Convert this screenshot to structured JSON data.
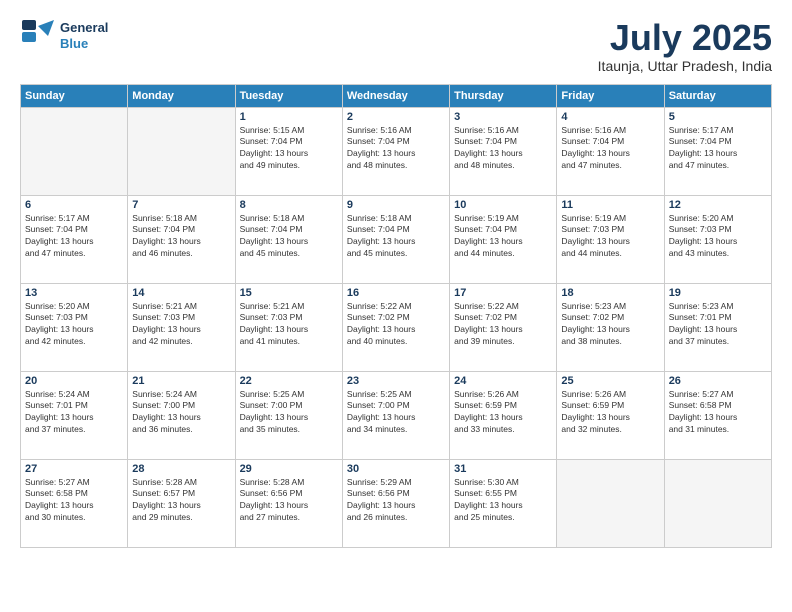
{
  "header": {
    "logo_line1": "General",
    "logo_line2": "Blue",
    "month": "July 2025",
    "location": "Itaunja, Uttar Pradesh, India"
  },
  "weekdays": [
    "Sunday",
    "Monday",
    "Tuesday",
    "Wednesday",
    "Thursday",
    "Friday",
    "Saturday"
  ],
  "weeks": [
    [
      {
        "day": "",
        "info": ""
      },
      {
        "day": "",
        "info": ""
      },
      {
        "day": "1",
        "info": "Sunrise: 5:15 AM\nSunset: 7:04 PM\nDaylight: 13 hours\nand 49 minutes."
      },
      {
        "day": "2",
        "info": "Sunrise: 5:16 AM\nSunset: 7:04 PM\nDaylight: 13 hours\nand 48 minutes."
      },
      {
        "day": "3",
        "info": "Sunrise: 5:16 AM\nSunset: 7:04 PM\nDaylight: 13 hours\nand 48 minutes."
      },
      {
        "day": "4",
        "info": "Sunrise: 5:16 AM\nSunset: 7:04 PM\nDaylight: 13 hours\nand 47 minutes."
      },
      {
        "day": "5",
        "info": "Sunrise: 5:17 AM\nSunset: 7:04 PM\nDaylight: 13 hours\nand 47 minutes."
      }
    ],
    [
      {
        "day": "6",
        "info": "Sunrise: 5:17 AM\nSunset: 7:04 PM\nDaylight: 13 hours\nand 47 minutes."
      },
      {
        "day": "7",
        "info": "Sunrise: 5:18 AM\nSunset: 7:04 PM\nDaylight: 13 hours\nand 46 minutes."
      },
      {
        "day": "8",
        "info": "Sunrise: 5:18 AM\nSunset: 7:04 PM\nDaylight: 13 hours\nand 45 minutes."
      },
      {
        "day": "9",
        "info": "Sunrise: 5:18 AM\nSunset: 7:04 PM\nDaylight: 13 hours\nand 45 minutes."
      },
      {
        "day": "10",
        "info": "Sunrise: 5:19 AM\nSunset: 7:04 PM\nDaylight: 13 hours\nand 44 minutes."
      },
      {
        "day": "11",
        "info": "Sunrise: 5:19 AM\nSunset: 7:03 PM\nDaylight: 13 hours\nand 44 minutes."
      },
      {
        "day": "12",
        "info": "Sunrise: 5:20 AM\nSunset: 7:03 PM\nDaylight: 13 hours\nand 43 minutes."
      }
    ],
    [
      {
        "day": "13",
        "info": "Sunrise: 5:20 AM\nSunset: 7:03 PM\nDaylight: 13 hours\nand 42 minutes."
      },
      {
        "day": "14",
        "info": "Sunrise: 5:21 AM\nSunset: 7:03 PM\nDaylight: 13 hours\nand 42 minutes."
      },
      {
        "day": "15",
        "info": "Sunrise: 5:21 AM\nSunset: 7:03 PM\nDaylight: 13 hours\nand 41 minutes."
      },
      {
        "day": "16",
        "info": "Sunrise: 5:22 AM\nSunset: 7:02 PM\nDaylight: 13 hours\nand 40 minutes."
      },
      {
        "day": "17",
        "info": "Sunrise: 5:22 AM\nSunset: 7:02 PM\nDaylight: 13 hours\nand 39 minutes."
      },
      {
        "day": "18",
        "info": "Sunrise: 5:23 AM\nSunset: 7:02 PM\nDaylight: 13 hours\nand 38 minutes."
      },
      {
        "day": "19",
        "info": "Sunrise: 5:23 AM\nSunset: 7:01 PM\nDaylight: 13 hours\nand 37 minutes."
      }
    ],
    [
      {
        "day": "20",
        "info": "Sunrise: 5:24 AM\nSunset: 7:01 PM\nDaylight: 13 hours\nand 37 minutes."
      },
      {
        "day": "21",
        "info": "Sunrise: 5:24 AM\nSunset: 7:00 PM\nDaylight: 13 hours\nand 36 minutes."
      },
      {
        "day": "22",
        "info": "Sunrise: 5:25 AM\nSunset: 7:00 PM\nDaylight: 13 hours\nand 35 minutes."
      },
      {
        "day": "23",
        "info": "Sunrise: 5:25 AM\nSunset: 7:00 PM\nDaylight: 13 hours\nand 34 minutes."
      },
      {
        "day": "24",
        "info": "Sunrise: 5:26 AM\nSunset: 6:59 PM\nDaylight: 13 hours\nand 33 minutes."
      },
      {
        "day": "25",
        "info": "Sunrise: 5:26 AM\nSunset: 6:59 PM\nDaylight: 13 hours\nand 32 minutes."
      },
      {
        "day": "26",
        "info": "Sunrise: 5:27 AM\nSunset: 6:58 PM\nDaylight: 13 hours\nand 31 minutes."
      }
    ],
    [
      {
        "day": "27",
        "info": "Sunrise: 5:27 AM\nSunset: 6:58 PM\nDaylight: 13 hours\nand 30 minutes."
      },
      {
        "day": "28",
        "info": "Sunrise: 5:28 AM\nSunset: 6:57 PM\nDaylight: 13 hours\nand 29 minutes."
      },
      {
        "day": "29",
        "info": "Sunrise: 5:28 AM\nSunset: 6:56 PM\nDaylight: 13 hours\nand 27 minutes."
      },
      {
        "day": "30",
        "info": "Sunrise: 5:29 AM\nSunset: 6:56 PM\nDaylight: 13 hours\nand 26 minutes."
      },
      {
        "day": "31",
        "info": "Sunrise: 5:30 AM\nSunset: 6:55 PM\nDaylight: 13 hours\nand 25 minutes."
      },
      {
        "day": "",
        "info": ""
      },
      {
        "day": "",
        "info": ""
      }
    ]
  ]
}
